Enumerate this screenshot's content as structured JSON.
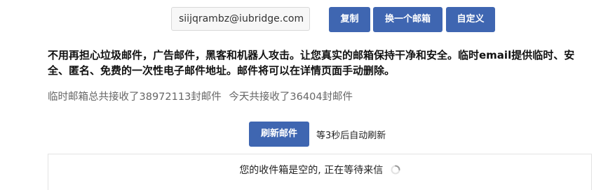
{
  "email": {
    "address": "siijqrambz@iubridge.com"
  },
  "actions": {
    "copy_label": "复制",
    "change_label": "换一个邮箱",
    "custom_label": "自定义"
  },
  "headline": "不用再担心垃圾邮件，广告邮件，黑客和机器人攻击。让您真实的邮箱保持干净和安全。临时email提供临时、安全、匿名、免费的一次性电子邮件地址。邮件将可以在详情页面手动删除。",
  "stats": {
    "total_text": "临时邮箱总共接收了38972113封邮件",
    "today_text": "今天共接收了36404封邮件"
  },
  "refresh": {
    "button_label": "刷新邮件",
    "note": "等3秒后自动刷新"
  },
  "inbox": {
    "empty_message": "您的收件箱是空的, 正在等待来信",
    "spinner_icon": "loading-spinner-icon"
  },
  "colors": {
    "accent": "#3f66b1"
  }
}
